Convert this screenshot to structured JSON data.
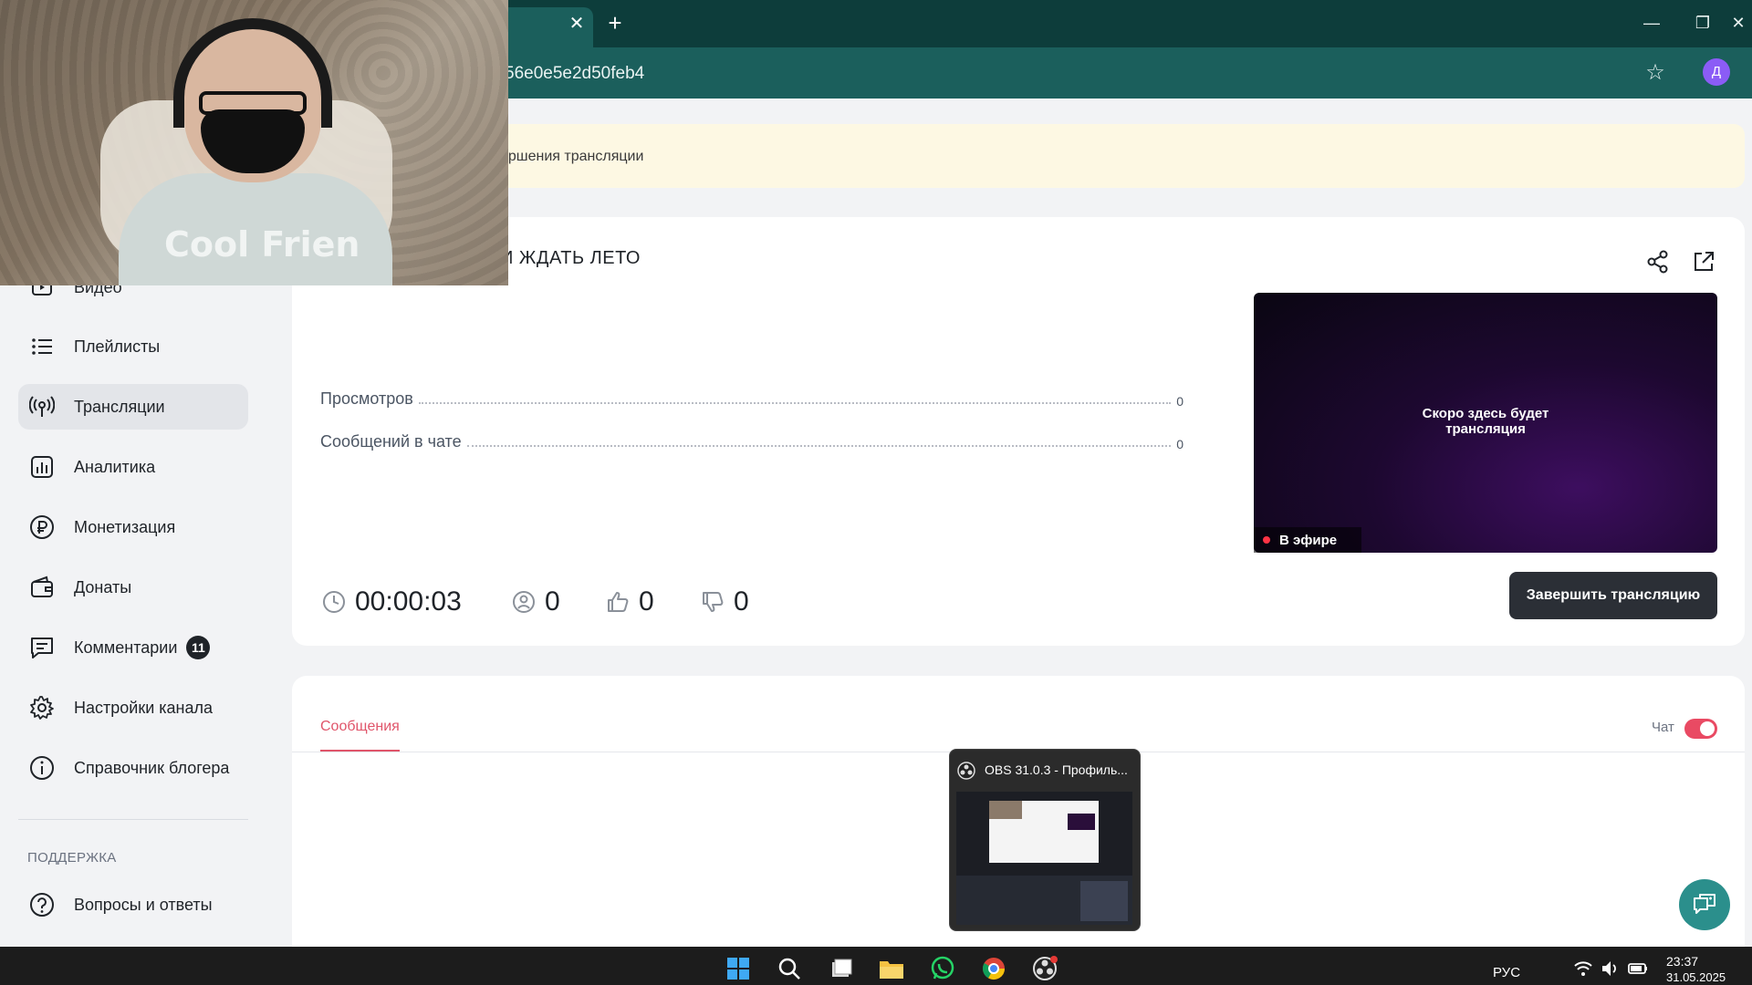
{
  "browser": {
    "new_tab": "+",
    "tab_close": "✕",
    "url_fragment": "56e0e5e2d50feb4",
    "profile_initial": "Д",
    "window_controls": [
      "—",
      "❐",
      "✕"
    ]
  },
  "sidebar": {
    "items": [
      {
        "label": "Видео",
        "icon": "video-icon"
      },
      {
        "label": "Плейлисты",
        "icon": "list-icon"
      },
      {
        "label": "Трансляции",
        "icon": "broadcast-icon",
        "active": true
      },
      {
        "label": "Аналитика",
        "icon": "analytics-icon"
      },
      {
        "label": "Монетизация",
        "icon": "ruble-icon"
      },
      {
        "label": "Донаты",
        "icon": "wallet-icon"
      },
      {
        "label": "Комментарии",
        "icon": "comments-icon",
        "badge": "11"
      },
      {
        "label": "Настройки канала",
        "icon": "gear-icon"
      },
      {
        "label": "Справочник блогера",
        "icon": "info-icon"
      }
    ],
    "support_section": "ПОДДЕРЖКА",
    "support_items": [
      {
        "label": "Вопросы и ответы",
        "icon": "question-icon"
      }
    ]
  },
  "banner": {
    "text": "ершения трансляции"
  },
  "stream": {
    "title": "И ЖДАТЬ ЛЕТО",
    "stats": [
      {
        "label": "Просмотров",
        "value": "0"
      },
      {
        "label": "Сообщений в чате",
        "value": "0"
      }
    ],
    "player_text_line1": "Скоро здесь будет",
    "player_text_line2": "трансляция",
    "live_label": "В эфире",
    "duration": "00:00:03",
    "viewers": "0",
    "likes": "0",
    "dislikes": "0",
    "end_button": "Завершить трансляцию"
  },
  "chat": {
    "tab_messages": "Сообщения",
    "toggle_label": "Чат",
    "toggle_on": true
  },
  "obs_popup": {
    "title": "OBS 31.0.3 - Профиль..."
  },
  "webcam": {
    "hoodie_text": "Cool Frien"
  },
  "taskbar": {
    "lang": "РУС",
    "time": "23:37",
    "date": "31.05.2025"
  },
  "colors": {
    "chrome_dark": "#0d3d3b",
    "chrome_tab": "#1b5f5c",
    "accent_pink": "#e0556a",
    "toggle_on": "#e94a63",
    "live_red": "#ff3344",
    "fab_teal": "#2b8f8c"
  }
}
